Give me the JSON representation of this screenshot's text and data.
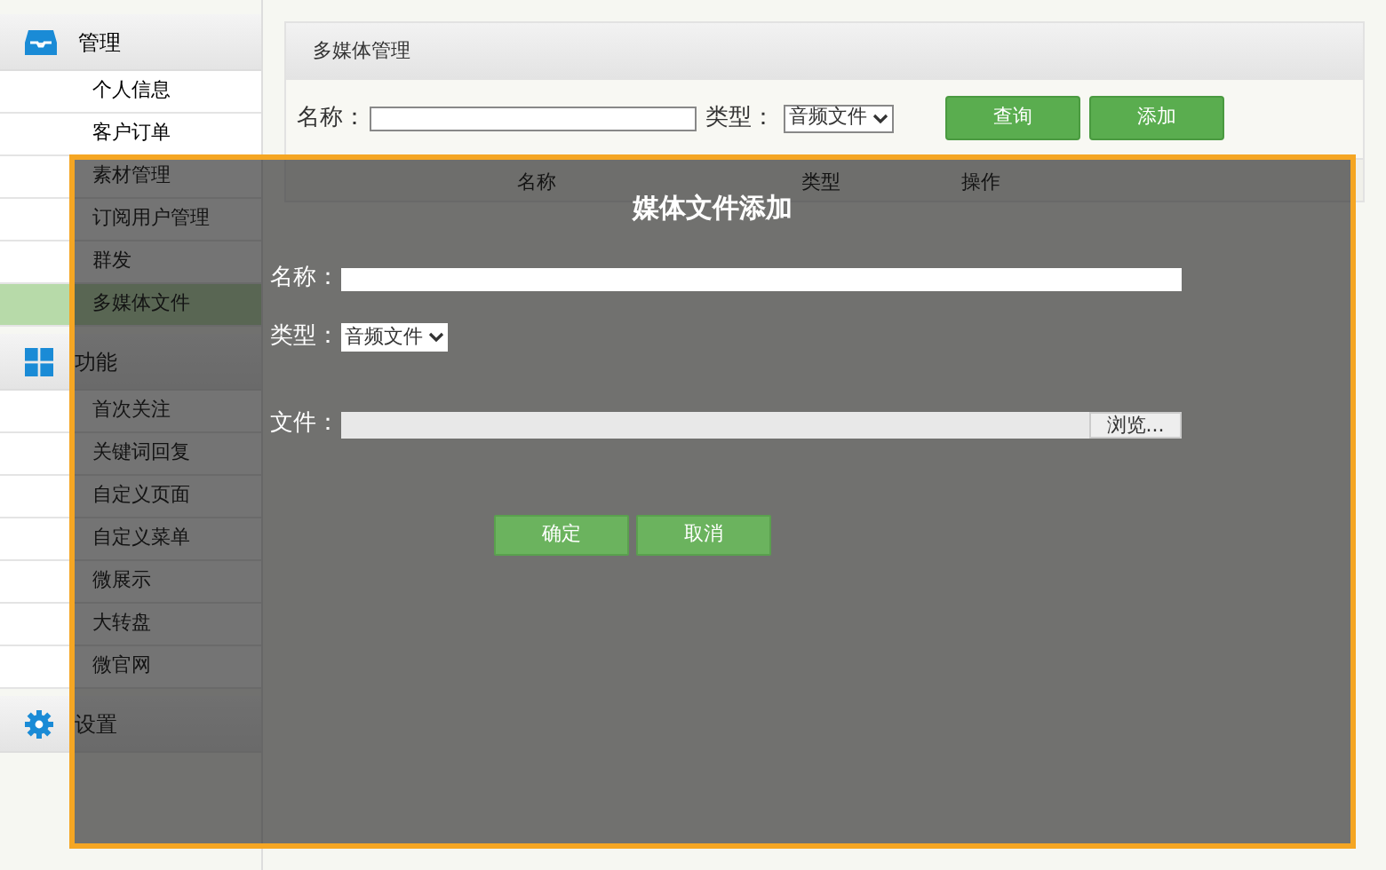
{
  "sidebar": {
    "groups": [
      {
        "label": "管理",
        "items": [
          {
            "label": "个人信息",
            "selected": false
          },
          {
            "label": "客户订单",
            "selected": false
          },
          {
            "label": "素材管理",
            "selected": false
          },
          {
            "label": "订阅用户管理",
            "selected": false
          },
          {
            "label": "群发",
            "selected": false
          },
          {
            "label": "多媒体文件",
            "selected": true
          }
        ]
      },
      {
        "label": "功能",
        "items": [
          {
            "label": "首次关注",
            "selected": false
          },
          {
            "label": "关键词回复",
            "selected": false
          },
          {
            "label": "自定义页面",
            "selected": false
          },
          {
            "label": "自定义菜单",
            "selected": false
          },
          {
            "label": "微展示",
            "selected": false
          },
          {
            "label": "大转盘",
            "selected": false
          },
          {
            "label": "微官网",
            "selected": false
          }
        ]
      },
      {
        "label": "设置"
      }
    ]
  },
  "panel": {
    "title": "多媒体管理",
    "filter": {
      "name_label": "名称：",
      "type_label": "类型：",
      "type_value": "音频文件"
    },
    "buttons": [
      "查询",
      "添加"
    ],
    "table": {
      "columns": [
        "名称",
        "类型",
        "操作"
      ]
    }
  },
  "dialog": {
    "title": "媒体文件添加",
    "fields": [
      {
        "kind": "text",
        "label": "名称："
      },
      {
        "kind": "select",
        "label": "类型：",
        "value": "音频文件"
      },
      {
        "kind": "file",
        "label": "文件：",
        "button": "浏览..."
      }
    ],
    "buttons": [
      "确定",
      "取消"
    ]
  }
}
